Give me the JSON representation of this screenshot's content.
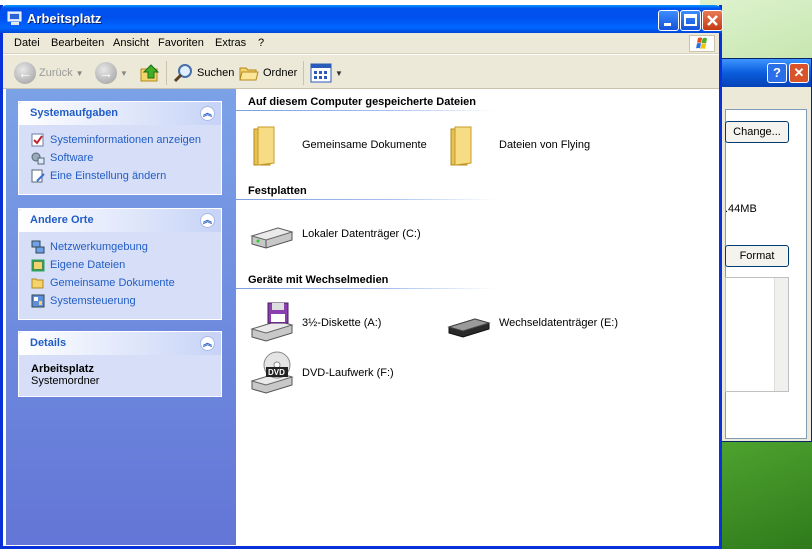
{
  "window": {
    "title": "Arbeitsplatz"
  },
  "menu": [
    "Datei",
    "Bearbeiten",
    "Ansicht",
    "Favoriten",
    "Extras",
    "?"
  ],
  "toolbar": {
    "back": "Zurück",
    "search": "Suchen",
    "folders": "Ordner"
  },
  "taskpane": {
    "system": {
      "title": "Systemaufgaben",
      "items": [
        "Systeminformationen anzeigen",
        "Software",
        "Eine Einstellung ändern"
      ]
    },
    "places": {
      "title": "Andere Orte",
      "items": [
        "Netzwerkumgebung",
        "Eigene Dateien",
        "Gemeinsame Dokumente",
        "Systemsteuerung"
      ]
    },
    "details": {
      "title": "Details",
      "name": "Arbeitsplatz",
      "type": "Systemordner"
    }
  },
  "content": {
    "groups": [
      {
        "title": "Auf diesem Computer gespeicherte Dateien",
        "items": [
          "Gemeinsame Dokumente",
          "Dateien von Flying"
        ]
      },
      {
        "title": "Festplatten",
        "items": [
          "Lokaler Datenträger (C:)"
        ]
      },
      {
        "title": "Geräte mit Wechselmedien",
        "items": [
          "3½-Diskette (A:)",
          "Wechseldatenträger (E:)",
          "DVD-Laufwerk (F:)"
        ]
      }
    ],
    "dvd_badge": "DVD"
  },
  "background_dialog": {
    "change": "Change...",
    "size": ".44MB",
    "format": "Format",
    "help": "?",
    "close": "✕"
  },
  "colors": {
    "titlebar": "#0054e3",
    "taskpane": "#6f8fe0",
    "link": "#215dc6"
  }
}
